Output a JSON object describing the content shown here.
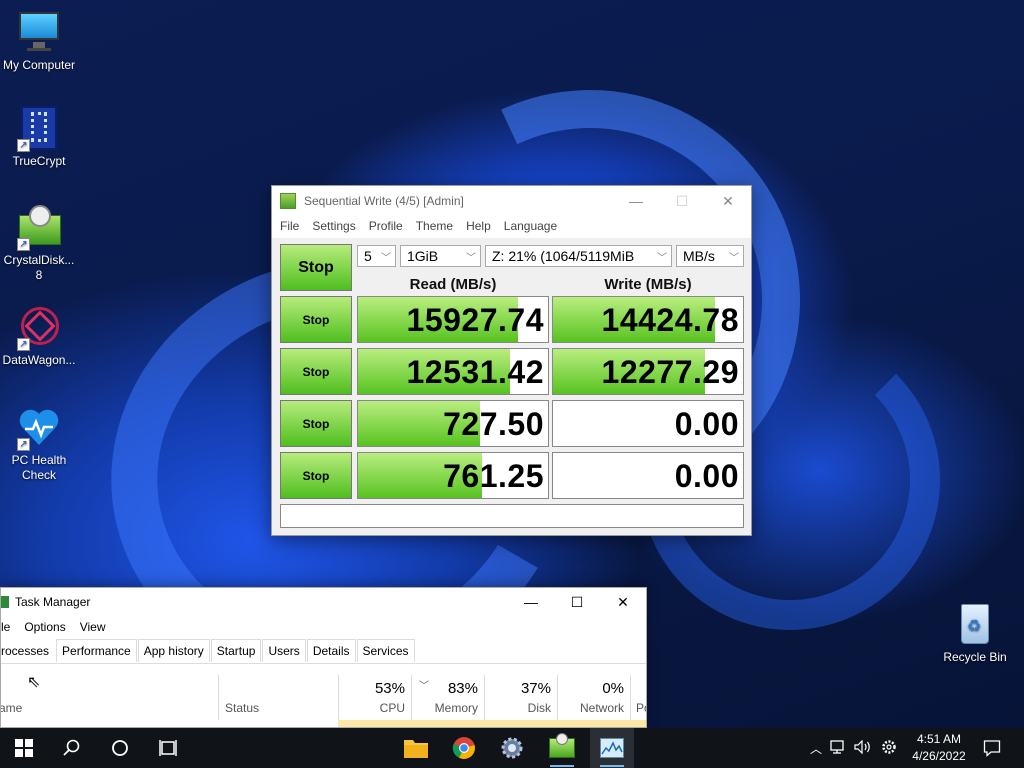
{
  "desktop": {
    "icons": [
      {
        "label": "My Computer"
      },
      {
        "label": "TrueCrypt"
      },
      {
        "label": "CrystalDisk...\n8"
      },
      {
        "label": "DataWagon..."
      },
      {
        "label": "PC Health\nCheck"
      },
      {
        "label": "Recycle Bin"
      }
    ]
  },
  "cdm": {
    "title": "Sequential Write (4/5) [Admin]",
    "menu": [
      "File",
      "Settings",
      "Profile",
      "Theme",
      "Help",
      "Language"
    ],
    "all_button": "Stop",
    "count": "5",
    "size": "1GiB",
    "drive": "Z: 21% (1064/5119MiB",
    "unit": "MB/s",
    "read_header": "Read (MB/s)",
    "write_header": "Write (MB/s)",
    "rows": [
      {
        "button": "Stop",
        "read": "15927.74",
        "read_fill": 0.84,
        "write": "14424.78",
        "write_fill": 0.85
      },
      {
        "button": "Stop",
        "read": "12531.42",
        "read_fill": 0.8,
        "write": "12277.29",
        "write_fill": 0.8
      },
      {
        "button": "Stop",
        "read": "727.50",
        "read_fill": 0.64,
        "write": "0.00",
        "write_fill": 0
      },
      {
        "button": "Stop",
        "read": "761.25",
        "read_fill": 0.65,
        "write": "0.00",
        "write_fill": 0
      }
    ],
    "status": ""
  },
  "taskmanager": {
    "title": "Task Manager",
    "menu": [
      "le",
      "Options",
      "View"
    ],
    "tabs": [
      "rocesses",
      "Performance",
      "App history",
      "Startup",
      "Users",
      "Details",
      "Services"
    ],
    "columns": {
      "name": "ame",
      "status": "Status",
      "cpu_pct": "53%",
      "cpu": "CPU",
      "mem_pct": "83%",
      "mem": "Memory",
      "disk_pct": "37%",
      "disk": "Disk",
      "net_pct": "0%",
      "net": "Network",
      "power": "Po"
    }
  },
  "taskbar": {
    "time": "4:51 AM",
    "date": "4/26/2022"
  },
  "colors": {
    "bar_green_light": "#b9ee80",
    "bar_green_dark": "#58c321",
    "taskbar": "#101418",
    "accent": "#76b9ed"
  }
}
